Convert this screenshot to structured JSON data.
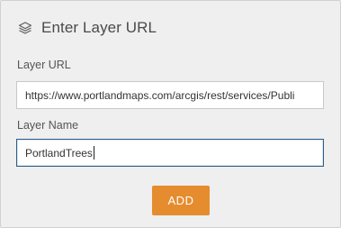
{
  "header": {
    "title": "Enter Layer URL",
    "icon": "layers-icon"
  },
  "layer_url": {
    "label": "Layer URL",
    "value": "https://www.portlandmaps.com/arcgis/rest/services/Publi"
  },
  "layer_name": {
    "label": "Layer Name",
    "value": "PortlandTrees"
  },
  "add_button": {
    "label": "ADD",
    "color": "#e58c2e"
  }
}
